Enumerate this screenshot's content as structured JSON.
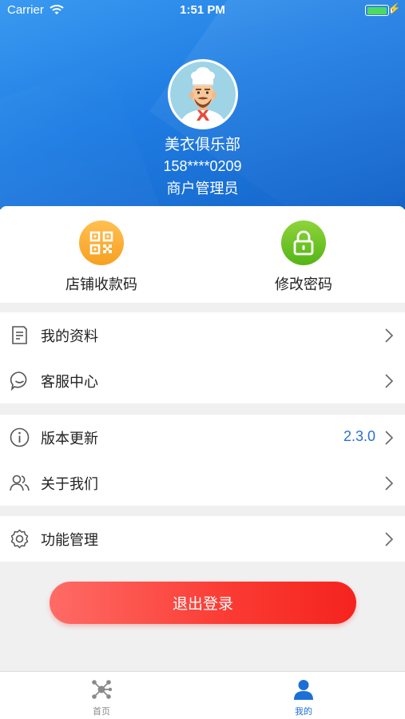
{
  "status_bar": {
    "carrier": "Carrier",
    "time": "1:51 PM",
    "battery_color": "#4cd964"
  },
  "profile": {
    "avatar_icon": "chef-avatar-icon",
    "name": "美衣俱乐部",
    "phone": "158****0209",
    "role": "商户管理员"
  },
  "quick_actions": [
    {
      "label": "店铺收款码",
      "icon": "qr-code-icon",
      "color": "#f7a022"
    },
    {
      "label": "修改密码",
      "icon": "lock-icon",
      "color": "#54b516"
    }
  ],
  "menu_groups": [
    [
      {
        "label": "我的资料",
        "icon": "document-icon"
      },
      {
        "label": "客服中心",
        "icon": "chat-bubble-icon"
      }
    ],
    [
      {
        "label": "版本更新",
        "icon": "info-icon",
        "value": "2.3.0"
      },
      {
        "label": "关于我们",
        "icon": "users-icon"
      }
    ],
    [
      {
        "label": "功能管理",
        "icon": "gear-icon"
      }
    ]
  ],
  "logout_label": "退出登录",
  "tab_bar": {
    "active_color": "#1c6fd6",
    "items": [
      {
        "label": "首页",
        "icon": "network-icon",
        "active": false
      },
      {
        "label": "我的",
        "icon": "person-icon",
        "active": true
      }
    ]
  },
  "colors": {
    "header": "#1f7de3",
    "accent_blue": "#2a6fd2",
    "logout": "#fa3a32"
  }
}
